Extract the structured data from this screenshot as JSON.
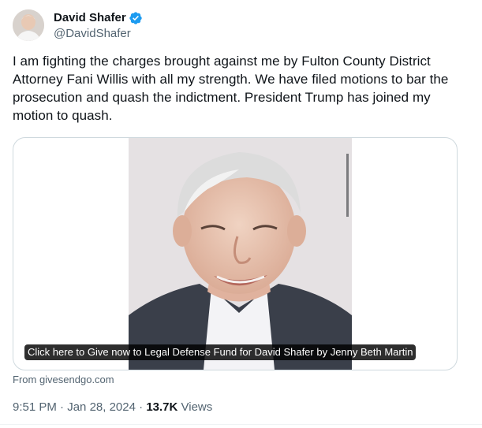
{
  "author": {
    "name": "David Shafer",
    "handle": "@DavidShafer",
    "verified_color": "#1d9bf0"
  },
  "tweet": {
    "text": "I am fighting the charges brought against me by Fulton County District Attorney Fani Willis with all my strength. We have filed motions to bar the prosecution and quash the indictment. President Trump has joined my motion to quash."
  },
  "card": {
    "caption": "Click here to Give now to Legal Defense Fund for David Shafer by Jenny Beth Martin",
    "source": "From givesendgo.com"
  },
  "meta": {
    "time": "9:51 PM",
    "separator": "·",
    "date": "Jan 28, 2024",
    "views_count": "13.7K",
    "views_label": "Views"
  },
  "icons": {
    "avatar": "avatar-image",
    "verified": "verified-badge-icon"
  }
}
